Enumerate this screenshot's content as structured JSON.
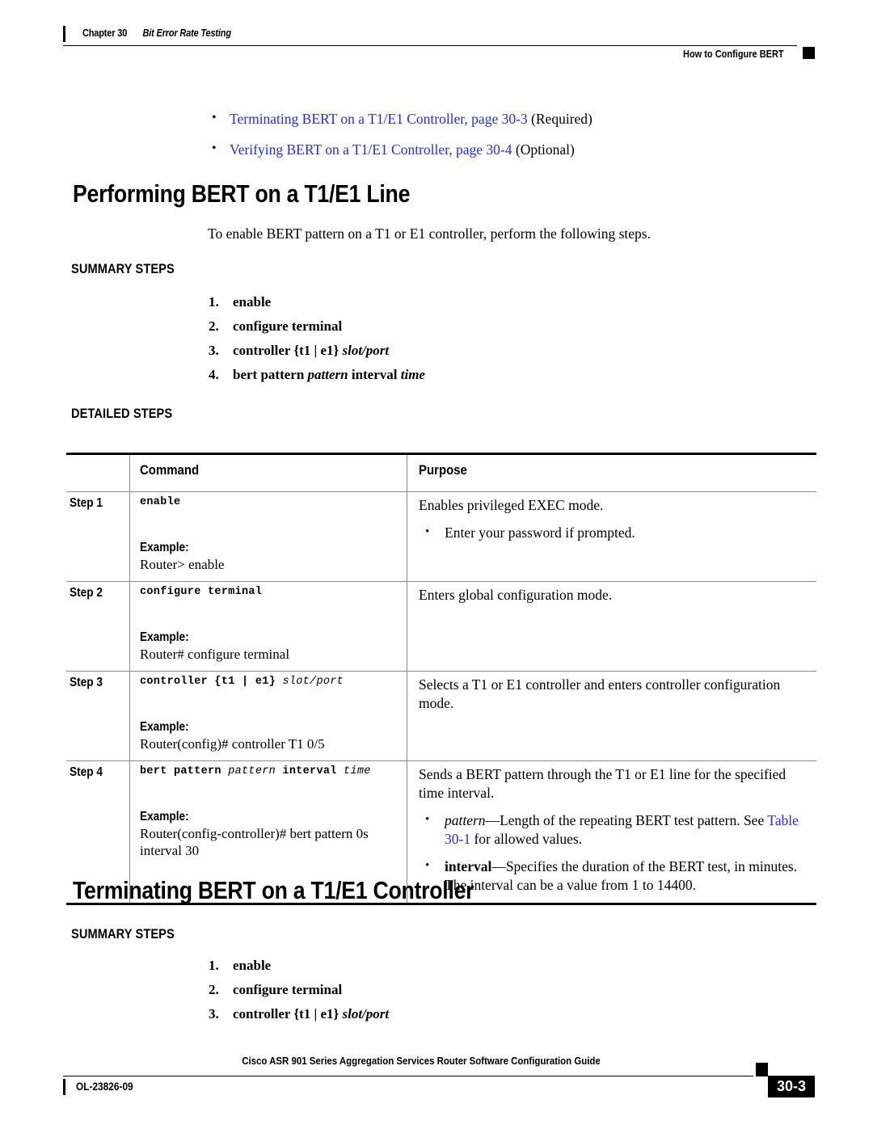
{
  "header": {
    "chapter_number": "Chapter 30",
    "chapter_title": "Bit Error Rate Testing",
    "right_label": "How to Configure BERT"
  },
  "top_links": [
    {
      "link_text": "Terminating BERT on a T1/E1 Controller, page 30-3",
      "suffix": " (Required)"
    },
    {
      "link_text": "Verifying BERT on a T1/E1 Controller, page 30-4",
      "suffix": " (Optional)"
    }
  ],
  "section1": {
    "heading": "Performing BERT on a T1/E1 Line",
    "intro": "To enable BERT pattern on a T1 or E1 controller, perform the following steps.",
    "summary_label": "SUMMARY STEPS",
    "summary_steps": [
      {
        "num": "1.",
        "bold": "enable",
        "italic": ""
      },
      {
        "num": "2.",
        "bold": "configure terminal",
        "italic": ""
      },
      {
        "num": "3.",
        "bold": "controller {t1 | e1} ",
        "italic": "slot/port"
      },
      {
        "num": "4.",
        "bold_a": "bert pattern ",
        "italic_a": "pattern",
        "bold_b": " interval ",
        "italic_b": "time"
      }
    ],
    "detailed_label": "DETAILED STEPS"
  },
  "table": {
    "columns": [
      "",
      "Command",
      "Purpose"
    ],
    "rows": [
      {
        "step": "Step 1",
        "command": "enable",
        "command_var": "",
        "example_label": "Example:",
        "example_text": "Router> enable",
        "purpose": "Enables privileged EXEC mode.",
        "bullets": [
          {
            "text": "Enter your password if prompted."
          }
        ]
      },
      {
        "step": "Step 2",
        "command": "configure terminal",
        "command_var": "",
        "example_label": "Example:",
        "example_text": "Router# configure terminal",
        "purpose": "Enters global configuration mode.",
        "bullets": []
      },
      {
        "step": "Step 3",
        "command": "controller {t1 | e1} ",
        "command_var": "slot/port",
        "example_label": "Example:",
        "example_text": "Router(config)# controller T1 0/5",
        "purpose": "Selects a T1 or E1 controller and enters controller configuration mode.",
        "bullets": []
      },
      {
        "step": "Step 4",
        "command_a": "bert pattern ",
        "command_var_a": "pattern",
        "command_b": " interval ",
        "command_var_b": "time",
        "example_label": "Example:",
        "example_text": "Router(config-controller)# bert pattern 0s interval 30",
        "purpose": "Sends a BERT pattern through the T1 or E1 line for the specified time interval.",
        "bullets": [
          {
            "term_italic": "pattern",
            "dash_text": "—Length of the repeating BERT test pattern. See ",
            "link": "Table 30-1",
            "tail": " for allowed values."
          },
          {
            "term_bold": "interval",
            "dash_text": "—Specifies the duration of the BERT test, in minutes. The interval can be a value from 1 to 14400."
          }
        ]
      }
    ]
  },
  "section2": {
    "heading": "Terminating BERT on a T1/E1 Controller",
    "summary_label": "SUMMARY STEPS",
    "summary_steps": [
      {
        "num": "1.",
        "bold": "enable",
        "italic": ""
      },
      {
        "num": "2.",
        "bold": "configure terminal",
        "italic": ""
      },
      {
        "num": "3.",
        "bold": "controller {t1 | e1} ",
        "italic": "slot/port"
      }
    ]
  },
  "footer": {
    "guide_title": "Cisco ASR 901 Series Aggregation Services Router Software Configuration Guide",
    "doc_id": "OL-23826-09",
    "page_number": "30-3"
  },
  "colors": {
    "link_blue": "#2a2ae0",
    "text_black": "#000000",
    "rule_gray": "#8a8a8a"
  }
}
